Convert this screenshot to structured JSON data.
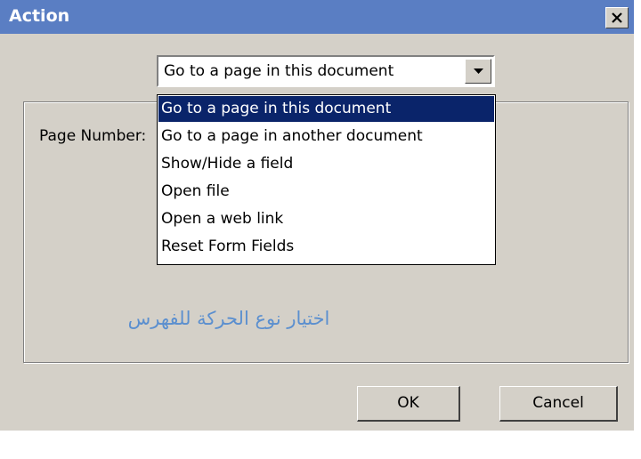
{
  "window": {
    "title": "Action",
    "close_icon": "close-icon"
  },
  "action_select": {
    "selected_value": "Go to a page in this document",
    "arrow_icon": "chevron-down-icon",
    "options": [
      "Go to a page in this document",
      "Go to a page in another document",
      "Show/Hide a field",
      "Open file",
      "Open a web link",
      "Reset Form Fields"
    ],
    "highlighted_index": 0
  },
  "panel": {
    "page_number_label": "Page Number:",
    "caption": "اختيار نوع الحركة للفهرس"
  },
  "buttons": {
    "ok": "OK",
    "cancel": "Cancel"
  },
  "colors": {
    "titlebar": "#5a7ec3",
    "selection": "#0a246a",
    "caption_text": "#5b8fcf",
    "dialog_face": "#d4d0c8"
  }
}
